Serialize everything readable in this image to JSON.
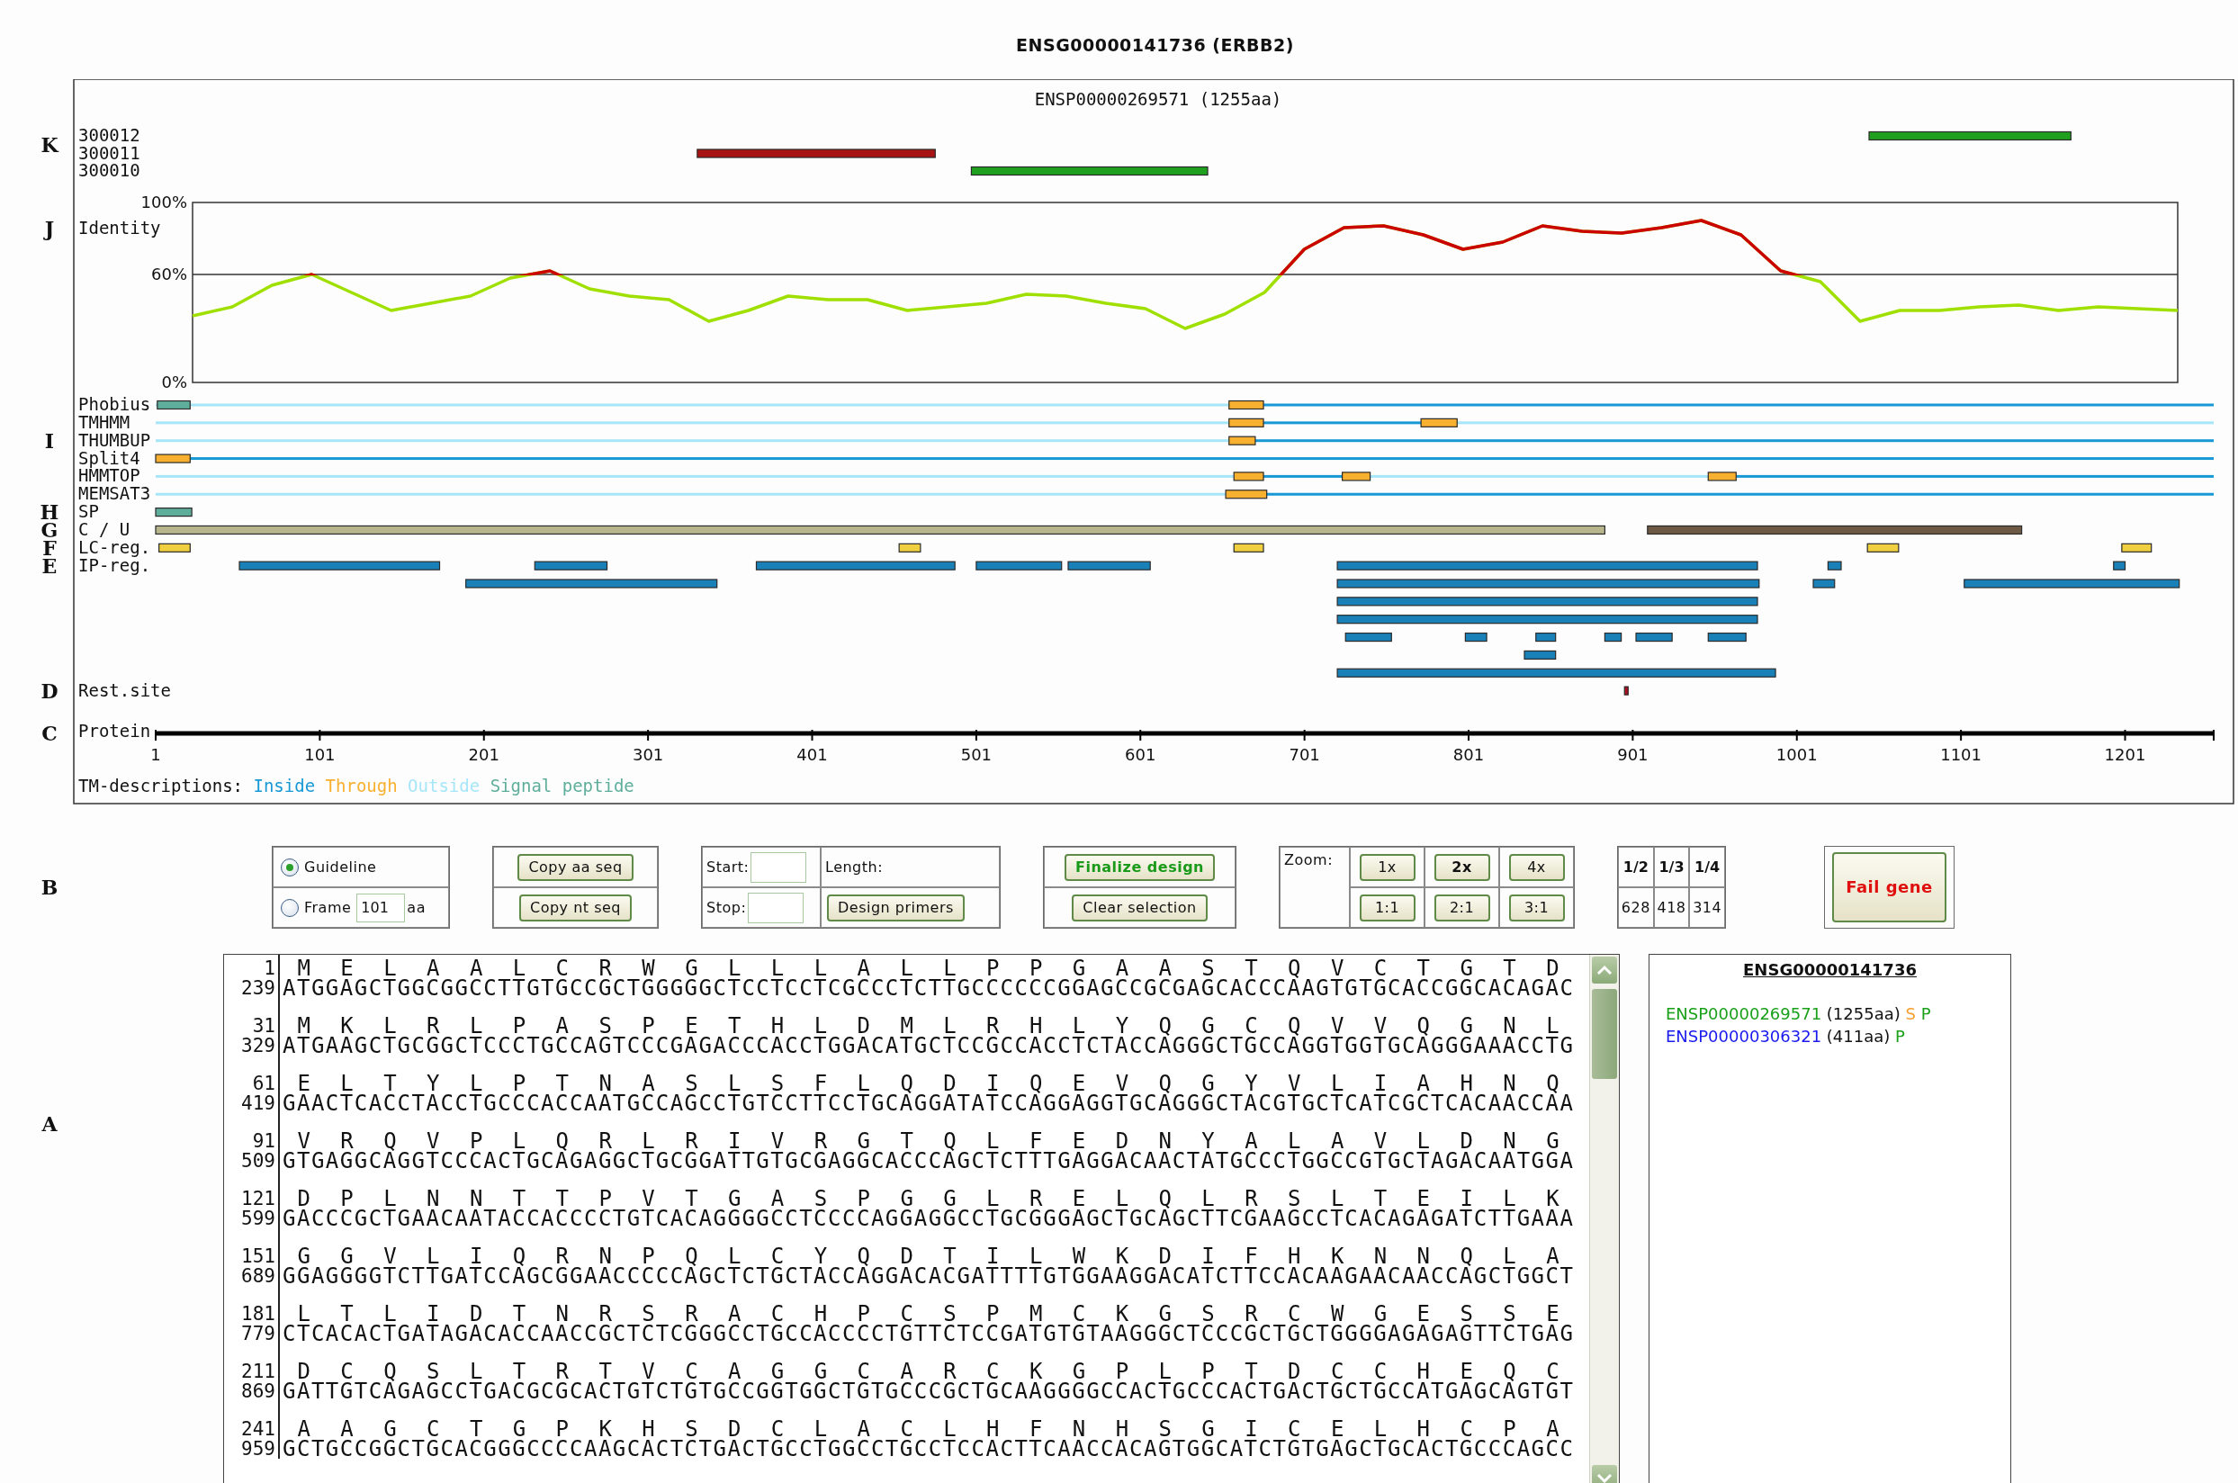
{
  "title": "ENSG00000141736 (ERBB2)",
  "figure": {
    "subtitle": "ENSP00000269571 (1255aa)",
    "peptide_tracks": {
      "section": "K",
      "tracks": [
        {
          "label": "300012",
          "rows": [
            {
              "boxes": [
                {
                  "color": "#1fa01f"
                }
              ]
            }
          ]
        },
        {
          "label": "300011",
          "rows": [
            {
              "boxes": [
                {
                  "color": "#a81414"
                }
              ]
            }
          ]
        },
        {
          "label": "300010",
          "rows": [
            {
              "boxes": [
                {
                  "color": "#1fa01f"
                }
              ]
            }
          ]
        }
      ]
    },
    "identity": {
      "section": "J",
      "chart_data": {
        "type": "line",
        "ylim": [
          0,
          100
        ],
        "yticks": [
          {
            "value": 0,
            "label": "0%"
          },
          {
            "value": 60,
            "label": "60%"
          },
          {
            "value": 100,
            "label": "100%"
          }
        ],
        "categories": [
          null,
          null,
          null,
          null,
          null,
          null,
          null,
          null,
          null,
          null,
          null,
          null,
          null,
          null,
          null,
          null,
          null,
          null,
          null,
          null,
          null,
          null,
          null,
          null,
          null,
          null,
          null,
          null,
          null,
          null,
          null,
          null,
          null,
          null,
          null,
          null,
          null,
          null,
          null,
          null,
          null,
          null,
          null,
          null,
          null,
          null,
          null,
          null,
          null,
          null,
          null
        ],
        "series": [
          {
            "name": "Identity",
            "color": "#a0e000",
            "values": [
              37,
              42,
              54,
              60,
              50,
              40,
              44,
              48,
              58,
              62,
              52,
              48,
              46,
              34,
              40,
              48,
              46,
              46,
              40,
              42,
              44,
              49,
              48,
              44,
              41,
              30,
              38,
              50,
              74,
              86,
              87,
              82,
              74,
              78,
              87,
              84,
              83,
              86,
              90,
              82,
              62,
              56,
              34,
              40,
              40,
              42,
              43,
              40,
              42,
              41,
              40
            ]
          }
        ]
      }
    },
    "tracks": [
      {
        "label": "Phobius",
        "rows": [
          {
            "lines": [
              {
                "color": "#a6e6f8"
              },
              {
                "color": "#1899d6"
              }
            ],
            "boxes": [
              {
                "color": "#5fae9c"
              },
              {
                "color": "#f8b030"
              }
            ]
          }
        ]
      },
      {
        "label": "TMHMM",
        "rows": [
          {
            "lines": [
              {
                "color": "#a6e6f8"
              },
              {
                "color": "#1899d6"
              },
              {
                "color": "#a6e6f8"
              }
            ],
            "boxes": [
              {
                "color": "#f8b030"
              },
              {
                "color": "#f8b030"
              }
            ]
          }
        ]
      },
      {
        "label": "THUMBUP",
        "section": "I",
        "rows": [
          {
            "lines": [
              {
                "color": "#a6e6f8"
              },
              {
                "color": "#1899d6"
              }
            ],
            "boxes": [
              {
                "color": "#f8b030"
              }
            ]
          }
        ]
      },
      {
        "label": "Split4",
        "rows": [
          {
            "lines": [
              {
                "color": "#1899d6"
              }
            ],
            "boxes": [
              {
                "color": "#f8b030"
              }
            ]
          }
        ]
      },
      {
        "label": "HMMTOP",
        "rows": [
          {
            "lines": [
              {
                "color": "#a6e6f8"
              },
              {
                "color": "#1899d6"
              },
              {
                "color": "#a6e6f8"
              },
              {
                "color": "#1899d6"
              }
            ],
            "boxes": [
              {
                "color": "#f8b030"
              },
              {
                "color": "#f8b030"
              },
              {
                "color": "#f8b030"
              }
            ]
          }
        ]
      },
      {
        "label": "MEMSAT3",
        "rows": [
          {
            "lines": [
              {
                "color": "#a6e6f8"
              },
              {
                "color": "#1899d6"
              }
            ],
            "boxes": [
              {
                "color": "#f8b030"
              }
            ]
          }
        ]
      },
      {
        "label": "SP",
        "section": "H",
        "rows": [
          {
            "boxes": [
              {
                "color": "#5fae9c"
              }
            ]
          }
        ]
      },
      {
        "label": "C / U",
        "section": "G",
        "rows": [
          {
            "boxes": [
              {
                "color": "#b8b68c"
              },
              {
                "color": "#6e5a44"
              }
            ]
          }
        ]
      },
      {
        "label": "LC-reg.",
        "section": "F",
        "rows": [
          {
            "boxes": [
              {
                "color": "#f0d040"
              },
              {
                "color": "#f0d040"
              },
              {
                "color": "#f0d040"
              },
              {
                "color": "#f0d040"
              },
              {
                "color": "#f0d040"
              }
            ]
          }
        ]
      },
      {
        "label": "IP-reg.",
        "section": "E",
        "rows": [
          {
            "boxes": [
              {
                "color": "#1a80b8"
              },
              {
                "color": "#1a80b8"
              },
              {
                "color": "#1a80b8"
              },
              {
                "color": "#1a80b8"
              },
              {
                "color": "#1a80b8"
              },
              {
                "color": "#1a80b8"
              },
              {
                "color": "#1a80b8"
              },
              {
                "color": "#1a80b8"
              }
            ]
          },
          {
            "boxes": [
              {
                "color": "#1a80b8"
              },
              {
                "color": "#1a80b8"
              },
              {
                "color": "#1a80b8"
              },
              {
                "color": "#1a80b8"
              }
            ]
          },
          {
            "boxes": [
              {
                "color": "#1a80b8"
              }
            ]
          },
          {
            "boxes": [
              {
                "color": "#1a80b8"
              }
            ]
          },
          {
            "boxes": [
              {
                "color": "#1a80b8"
              },
              {
                "color": "#1a80b8"
              },
              {
                "color": "#1a80b8"
              },
              {
                "color": "#1a80b8"
              },
              {
                "color": "#1a80b8"
              },
              {
                "color": "#1a80b8"
              }
            ]
          },
          {
            "boxes": [
              {
                "color": "#1a80b8"
              }
            ]
          },
          {
            "boxes": [
              {
                "color": "#1a80b8"
              }
            ]
          }
        ]
      },
      {
        "label": "Rest.site",
        "section": "D",
        "rows": [
          {
            "boxes": [
              {
                "color": "#aa1122"
              }
            ]
          }
        ]
      }
    ],
    "ruler": {
      "section": "C",
      "label": "Protein",
      "ticks": [
        "1",
        "101",
        "201",
        "301",
        "401",
        "501",
        "601",
        "701",
        "801",
        "901",
        "1001",
        "1101",
        "1201"
      ]
    },
    "legend": {
      "label": "TM-descriptions:",
      "items": [
        {
          "text": "Inside",
          "color": "#1899d6"
        },
        {
          "text": "Through",
          "color": "#f8b030"
        },
        {
          "text": "Outside",
          "color": "#a6e6f8"
        },
        {
          "text": "Signal peptide",
          "color": "#5fae9c"
        }
      ]
    }
  },
  "controls": {
    "section": "B",
    "reading_frame": [
      {
        "label": "Guideline",
        "selected": true,
        "kind": "plain"
      },
      {
        "label": "Frame",
        "selected": false,
        "kind": "frame",
        "value": "101",
        "unit": "aa"
      }
    ],
    "copy_buttons": [
      "Copy aa seq",
      "Copy nt seq"
    ],
    "range": {
      "start_label": "Start:",
      "length_label": "Length:",
      "stop_label": "Stop:",
      "button": "Design primers"
    },
    "design_buttons": [
      {
        "label": "Finalize design",
        "kind": "primary"
      },
      {
        "label": "Clear selection",
        "kind": "normal"
      }
    ],
    "zoom": {
      "label": "Zoom:",
      "levels": [
        {
          "label": "1x",
          "selected": false
        },
        {
          "label": "2x",
          "selected": true
        },
        {
          "label": "4x",
          "selected": false
        }
      ],
      "ratios": [
        "1:1",
        "2:1",
        "3:1"
      ]
    },
    "fractions": [
      {
        "header": "1/2",
        "value": "628"
      },
      {
        "header": "1/3",
        "value": "418"
      },
      {
        "header": "1/4",
        "value": "314"
      }
    ],
    "fail_button": "Fail gene"
  },
  "sequence": {
    "section": "A",
    "rows": [
      {
        "aa_start": "1",
        "aa": "MELAALCRWGLLLALLPPGAASTQVCTGTD",
        "nt_start": "239",
        "nt": "ATGGAGCTGGCGGCCTTGTGCCGCTGGGGGCTCCTCCTCGCCCTCTTGCCCCCCGGAGCCGCGAGCACCCAAGTGTGCACCGGCACAGAC"
      },
      {
        "aa_start": "31",
        "aa": "MKLRLPASPETHLDMLRHLYQGCQVVQGNL",
        "nt_start": "329",
        "nt": "ATGAAGCTGCGGCTCCCTGCCAGTCCCGAGACCCACCTGGACATGCTCCGCCACCTCTACCAGGGCTGCCAGGTGGTGCAGGGAAACCTG"
      },
      {
        "aa_start": "61",
        "aa": "ELTYLPTNASLSFLQDIQEVQGYVLIAHNQ",
        "nt_start": "419",
        "nt": "GAACTCACCTACCTGCCCACCAATGCCAGCCTGTCCTTCCTGCAGGATATCCAGGAGGTGCAGGGCTACGTGCTCATCGCTCACAACCAA"
      },
      {
        "aa_start": "91",
        "aa": "VRQVPLQRLRIVRGTQLFEDNYALAVLDNG",
        "nt_start": "509",
        "nt": "GTGAGGCAGGTCCCACTGCAGAGGCTGCGGATTGTGCGAGGCACCCAGCTCTTTGAGGACAACTATGCCCTGGCCGTGCTAGACAATGGA"
      },
      {
        "aa_start": "121",
        "aa": "DPLNNTTPVTGASPGGLRELQLRSLTEILK",
        "nt_start": "599",
        "nt": "GACCCGCTGAACAATACCACCCCTGTCACAGGGGCCTCCCCAGGAGGCCTGCGGGAGCTGCAGCTTCGAAGCCTCACAGAGATCTTGAAA"
      },
      {
        "aa_start": "151",
        "aa": "GGVLIQRNPQLCYQDTILWKDIFHKNNQLA",
        "nt_start": "689",
        "nt": "GGAGGGGTCTTGATCCAGCGGAACCCCCAGCTCTGCTACCAGGACACGATTTTGTGGAAGGACATCTTCCACAAGAACAACCAGCTGGCT"
      },
      {
        "aa_start": "181",
        "aa": "LTLIDTNRSRACHPCSPMCKGSRCWGESSE",
        "nt_start": "779",
        "nt": "CTCACACTGATAGACACCAACCGCTCTCGGGCCTGCCACCCCTGTTCTCCGATGTGTAAGGGCTCCCGCTGCTGGGGAGAGAGTTCTGAG"
      },
      {
        "aa_start": "211",
        "aa": "DCQSLTRTVCAGGCARCKGPLPTDCCHEQC",
        "nt_start": "869",
        "nt": "GATTGTCAGAGCCTGACGCGCACTGTCTGTGCCGGTGGCTGTGCCCGCTGCAAGGGGCCACTGCCCACTGACTGCTGCCATGAGCAGTGT"
      },
      {
        "aa_start": "241",
        "aa": "AAGCTGPKHSDCLACLHFNHSGICELHCPA",
        "nt_start": "959",
        "nt": "GCTGCCGGCTGCACGGGCCCCAAGCACTCTGACTGCCTGGCCTGCCTCCACTTCAACCACAGTGGCATCTGTGAGCTGCACTGCCCAGCC"
      }
    ]
  },
  "gene_panel": {
    "title": "ENSG00000141736",
    "proteins": [
      {
        "id": "ENSP00000269571",
        "color": "#1aa01a",
        "length": "(1255aa)",
        "flags": [
          {
            "text": "S",
            "color": "#f5a030"
          },
          {
            "text": "P",
            "color": "#1aa01a"
          }
        ]
      },
      {
        "id": "ENSP00000306321",
        "color": "#1a1aee",
        "length": "(411aa)",
        "flags": [
          {
            "text": "P",
            "color": "#1aa01a"
          }
        ]
      }
    ]
  }
}
